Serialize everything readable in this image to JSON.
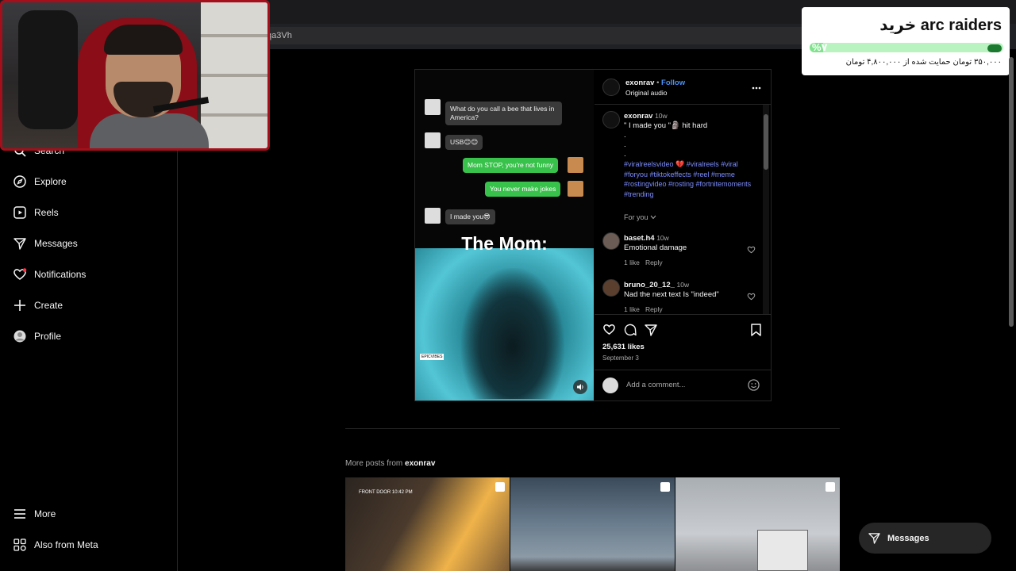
{
  "browser": {
    "address_fragment": "qa3Vh"
  },
  "donation": {
    "title": "خرید arc raiders",
    "percent_text": "%۷",
    "progress": 0.07,
    "subtitle": "۳۵۰,۰۰۰ تومان حمایت شده از ۴,۸۰۰,۰۰۰ تومان"
  },
  "sidebar": {
    "items": [
      {
        "label": "Search",
        "icon": "search-icon"
      },
      {
        "label": "Explore",
        "icon": "compass-icon"
      },
      {
        "label": "Reels",
        "icon": "reels-icon"
      },
      {
        "label": "Messages",
        "icon": "send-icon"
      },
      {
        "label": "Notifications",
        "icon": "heart-icon"
      },
      {
        "label": "Create",
        "icon": "plus-icon"
      },
      {
        "label": "Profile",
        "icon": "avatar-icon"
      },
      {
        "label": "More",
        "icon": "menu-icon"
      },
      {
        "label": "Also from Meta",
        "icon": "meta-grid-icon"
      }
    ]
  },
  "post": {
    "media": {
      "chat": [
        {
          "side": "in",
          "text": "What do you call a bee that lives in America?"
        },
        {
          "side": "in",
          "text": "USB😊😊"
        },
        {
          "side": "out",
          "text": "Mom STOP, you're not funny"
        },
        {
          "side": "out",
          "text": "You never make jokes"
        },
        {
          "side": "in",
          "text": "I made you😎"
        }
      ],
      "caption_overlay": "The Mom:",
      "watermark": "EPICVIBES"
    },
    "header": {
      "username": "exonrav",
      "separator": "•",
      "follow": "Follow",
      "audio": "Original audio"
    },
    "caption": {
      "username": "exonrav",
      "age": "10w",
      "text": "\" I made you \"🗿 hit hard",
      "dots": ".",
      "hashtags": "#viralreelsvideo 💔 #viralreels #viral #foryou #tiktokeffects #reel #meme #rostingvideo #rosting #fortnitemoments #trending"
    },
    "for_you": "For you",
    "comments": [
      {
        "user": "baset.h4",
        "age": "10w",
        "text": "Emotional damage",
        "likes": "1 like",
        "reply": "Reply"
      },
      {
        "user": "bruno_20_12_",
        "age": "10w",
        "text": "Nad the next text Is \"indeed\"",
        "likes": "1 like",
        "reply": "Reply"
      }
    ],
    "likes": "25,631 likes",
    "date": "September 3",
    "add_comment_placeholder": "Add a comment..."
  },
  "more_posts": {
    "prefix": "More posts from ",
    "user": "exonrav",
    "thumb_overlay": "FRONT DOOR  10:42 PM"
  },
  "fab": {
    "label": "Messages"
  }
}
